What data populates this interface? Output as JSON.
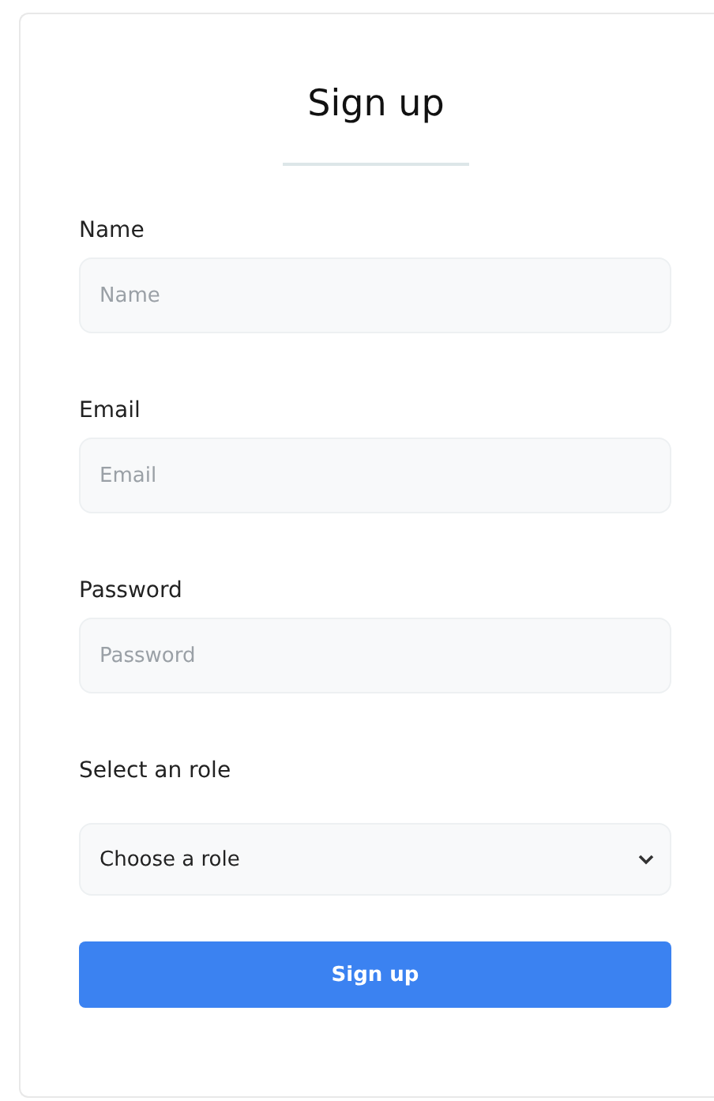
{
  "title": "Sign up",
  "fields": [
    {
      "label": "Name",
      "placeholder": "Name"
    },
    {
      "label": "Email",
      "placeholder": "Email"
    },
    {
      "label": "Password",
      "placeholder": "Password"
    }
  ],
  "role": {
    "label": "Select an role",
    "value": "Choose a role"
  },
  "submit": "Sign up"
}
